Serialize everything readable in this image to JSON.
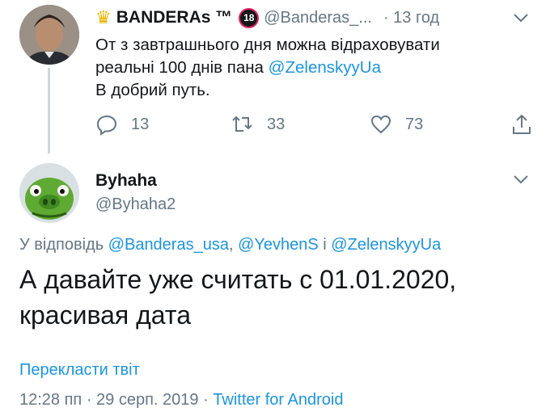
{
  "parent_tweet": {
    "display_name": "BANDERAs ™",
    "age_badge": "18",
    "handle": "@Banderas_...",
    "time": "· 13 год",
    "text_line1": "От з завтрашнього дня можна відраховувати",
    "text_line2_prefix": "реальні 100 днів пана ",
    "text_line2_mention": "@ZelenskyyUa",
    "text_line3": "В добрий путь.",
    "replies": "13",
    "retweets": "33",
    "likes": "73"
  },
  "reply_tweet": {
    "display_name": "Byhaha",
    "handle": "@Byhaha2",
    "reply_prefix": "У відповідь ",
    "reply_mention1": "@Banderas_usa",
    "reply_sep1": ", ",
    "reply_mention2": "@YevhenS",
    "reply_sep2": " і ",
    "reply_mention3": "@ZelenskyyUa",
    "text_line1": "А давайте уже считать с 01.01.2020,",
    "text_line2": "красивая дата",
    "translate_label": "Перекласти твіт",
    "timestamp": "12:28 пп · 29 серп. 2019 · ",
    "source": "Twitter for Android"
  },
  "colors": {
    "accent": "#1b95e0",
    "muted": "#657786",
    "text": "#14171a"
  },
  "icons": [
    "crown-emoji",
    "adult-18-badge",
    "chevron-down-icon",
    "reply-icon",
    "retweet-icon",
    "like-icon",
    "share-icon"
  ]
}
